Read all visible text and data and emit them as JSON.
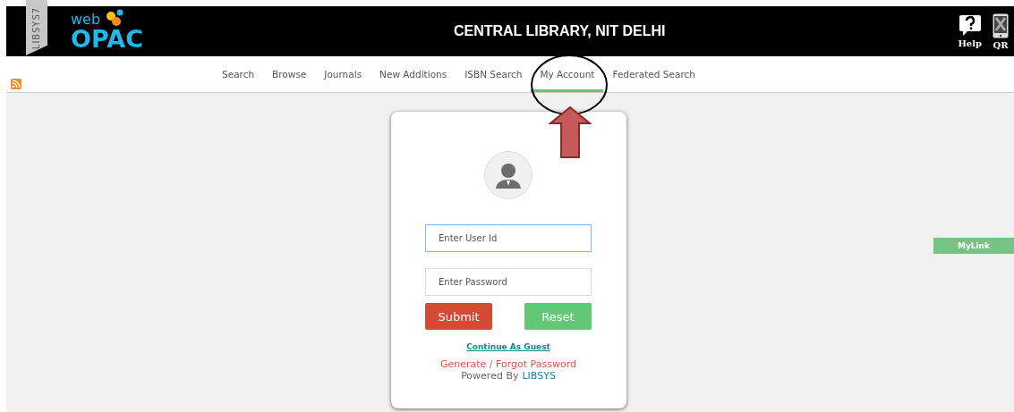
{
  "header": {
    "ribbon": "LIBSYS7",
    "logo_small": "web",
    "logo_big": "OPAC",
    "title": "CENTRAL LIBRARY, NIT DELHI",
    "actions": [
      {
        "label": "Help",
        "kind": "help"
      },
      {
        "label": "QR",
        "kind": "qr"
      }
    ]
  },
  "nav": [
    {
      "label": "Search",
      "selected": false
    },
    {
      "label": "Browse",
      "selected": false
    },
    {
      "label": "Journals",
      "selected": false
    },
    {
      "label": "New Additions",
      "selected": false
    },
    {
      "label": "ISBN Search",
      "selected": false
    },
    {
      "label": "My Account",
      "selected": true
    },
    {
      "label": "Federated Search",
      "selected": false
    }
  ],
  "login": {
    "user_placeholder": "Enter User Id",
    "password_placeholder": "Enter Password",
    "submit": "Submit",
    "reset": "Reset",
    "guest": "Continue As Guest",
    "forgot": "Generate / Forgot Password",
    "powered_by": "Powered By",
    "brand": "LIBSYS"
  },
  "side_tab": "MyLink"
}
